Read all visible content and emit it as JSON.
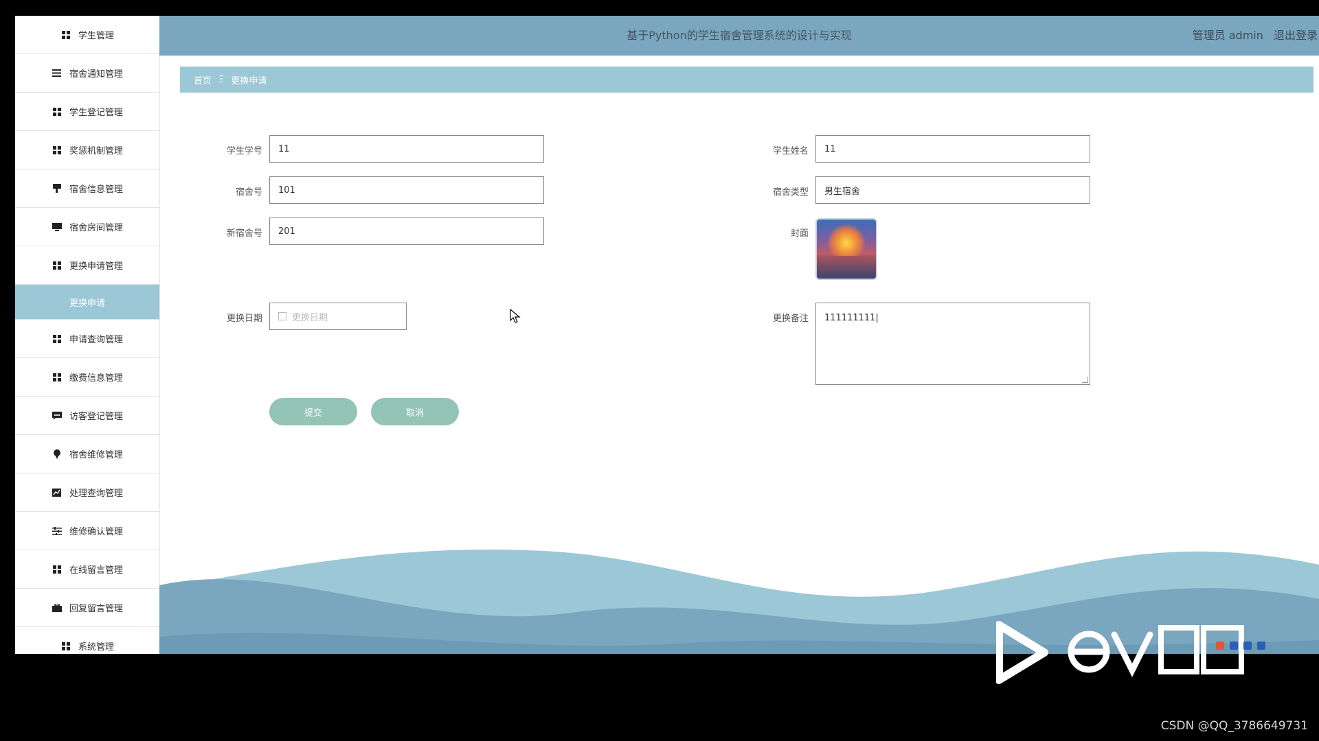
{
  "header": {
    "title": "基于Python的学生宿舍管理系统的设计与实现",
    "user_label": "管理员 admin",
    "logout_label": "退出登录"
  },
  "sidebar": {
    "items": [
      {
        "label": "学生管理",
        "icon": "grid-icon"
      },
      {
        "label": "宿舍通知管理",
        "icon": "list-icon"
      },
      {
        "label": "学生登记管理",
        "icon": "grid-icon"
      },
      {
        "label": "奖惩机制管理",
        "icon": "grid-icon"
      },
      {
        "label": "宿舍信息管理",
        "icon": "flag-icon"
      },
      {
        "label": "宿舍房间管理",
        "icon": "monitor-icon"
      },
      {
        "label": "更换申请管理",
        "icon": "grid-icon"
      },
      {
        "label": "更换申请",
        "icon": "",
        "active": true
      },
      {
        "label": "申请查询管理",
        "icon": "grid-icon"
      },
      {
        "label": "缴费信息管理",
        "icon": "grid-icon"
      },
      {
        "label": "访客登记管理",
        "icon": "chat-icon"
      },
      {
        "label": "宿舍维修管理",
        "icon": "pin-icon"
      },
      {
        "label": "处理查询管理",
        "icon": "chart-icon"
      },
      {
        "label": "维修确认管理",
        "icon": "sliders-icon"
      },
      {
        "label": "在线留言管理",
        "icon": "grid-icon"
      },
      {
        "label": "回复留言管理",
        "icon": "briefcase-icon"
      },
      {
        "label": "系统管理",
        "icon": "grid-icon"
      }
    ]
  },
  "breadcrumb": {
    "home": "首页",
    "separator": "Ξ",
    "current": "更换申请"
  },
  "form": {
    "student_id": {
      "label": "学生学号",
      "value": "11"
    },
    "student_name": {
      "label": "学生姓名",
      "value": "11"
    },
    "dorm_no": {
      "label": "宿舍号",
      "value": "101"
    },
    "dorm_type": {
      "label": "宿舍类型",
      "value": "男生宿舍"
    },
    "new_dorm_no": {
      "label": "新宿舍号",
      "value": "201"
    },
    "cover": {
      "label": "封面"
    },
    "change_date": {
      "label": "更换日期",
      "placeholder": "更换日期"
    },
    "remark": {
      "label": "更换备注",
      "value": "111111111|"
    },
    "submit_label": "提交",
    "cancel_label": "取消"
  },
  "overlay": {
    "watermark": "CSDN @QQ_3786649731"
  },
  "colors": {
    "header": "#7aa6bf",
    "breadcrumb": "#9cc7d6",
    "active_nav": "#9cc7d6",
    "button": "#93c4b5"
  }
}
